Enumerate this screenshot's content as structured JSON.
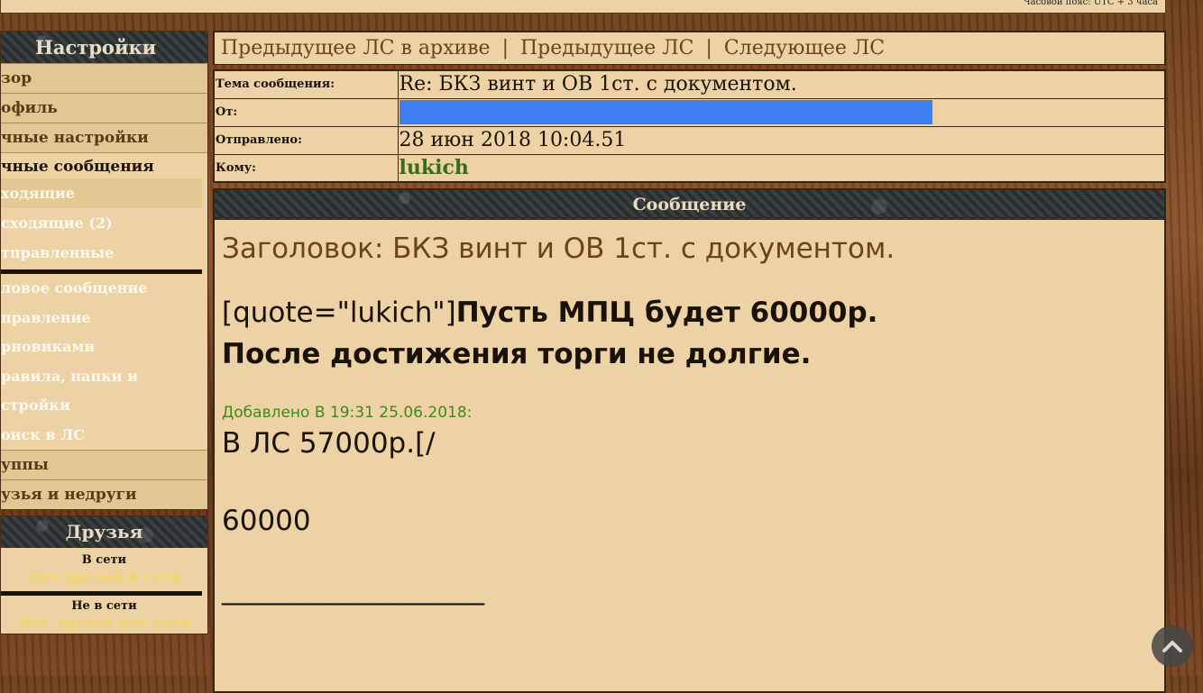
{
  "topbar": {
    "timezone": "Часовой пояс: UTC + 3 часа"
  },
  "sidebar": {
    "title": "Настройки",
    "items": [
      {
        "label": "зор"
      },
      {
        "label": "офиль"
      },
      {
        "label": "чные настройки"
      }
    ],
    "pm": {
      "head": "чные сообщения",
      "folders": [
        {
          "label": "ходящие"
        },
        {
          "label": "сходящие (2)"
        },
        {
          "label": "тправленные"
        }
      ],
      "links": [
        {
          "label": "ловое сообщение"
        },
        {
          "label": "правление"
        },
        {
          "label": "рновиками"
        },
        {
          "label": "равила, папки и"
        },
        {
          "label": "стройки"
        },
        {
          "label": "оиск в ЛС"
        }
      ]
    },
    "bottom_items": [
      {
        "label": "уппы"
      },
      {
        "label": "узья и недруги"
      }
    ],
    "friends": {
      "title": "Друзья",
      "online_label": "В сети",
      "online_empty": "Нет друзей в сети",
      "offline_label": "Не в сети",
      "offline_empty": "Нет друзей вне сети"
    }
  },
  "nav": {
    "prev_archive": "Предыдущее ЛС в архиве",
    "prev": "Предыдущее ЛС",
    "next": "Следующее ЛС",
    "separator": "|"
  },
  "header": {
    "subject_label": "Тема сообщения:",
    "subject_value": "Re: БКЗ винт и ОВ 1ст. с документом.",
    "from_label": "От:",
    "sent_label": "Отправлено:",
    "sent_value": "28 июн 2018 10:04.51",
    "to_label": "Кому:",
    "to_value": "lukich"
  },
  "message": {
    "head": "Сообщение",
    "subject_line": "Заголовок: БКЗ винт и ОВ 1ст. с документом.",
    "quote_prefix": "[quote=\"lukich\"]",
    "quote_bold_1": "Пусть МПЦ будет 60000р.",
    "quote_bold_2": "После достижения торги не долгие.",
    "added": "Добавлено В 19:31 25.06.2018:",
    "line_ls": "В ЛС 57000р.[/",
    "line_60000": "60000",
    "underline": "____________________"
  },
  "colors": {
    "panel_bg": "#ecd2a4",
    "link_brown": "#6b4418",
    "username_green": "#3b6b1a",
    "added_green": "#3d8a1a",
    "redaction_blue": "#3b7ff0"
  }
}
